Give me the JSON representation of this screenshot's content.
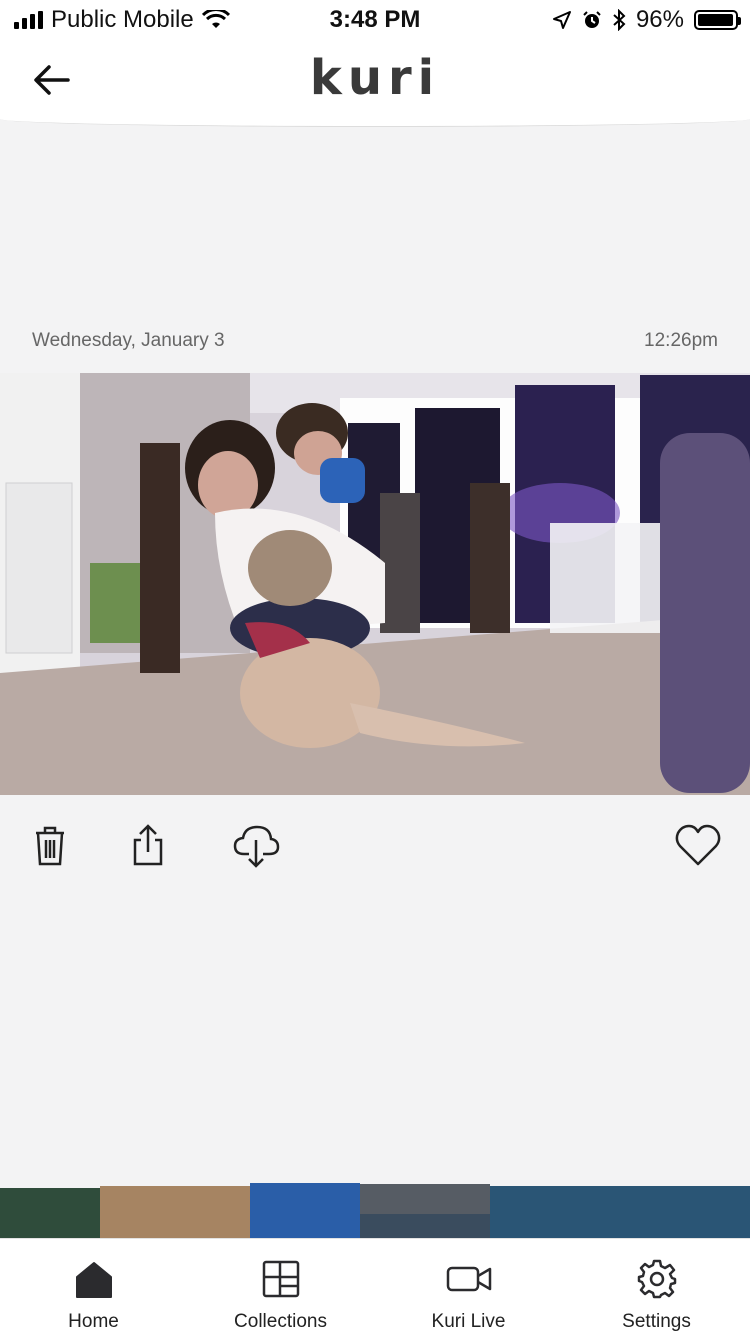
{
  "status_bar": {
    "carrier": "Public Mobile",
    "time": "3:48 PM",
    "battery_percent": "96%",
    "battery_level": 0.96
  },
  "header": {
    "logo": "kuri",
    "back_icon": "arrow-left-icon"
  },
  "capture": {
    "date": "Wednesday, January 3",
    "time": "12:26pm"
  },
  "actions": {
    "icons": [
      "trash-icon",
      "share-icon",
      "cloud-download-icon",
      "heart-icon"
    ]
  },
  "tabs": [
    {
      "label": "Home",
      "icon": "home-icon",
      "active": true
    },
    {
      "label": "Collections",
      "icon": "collections-icon",
      "active": false
    },
    {
      "label": "Kuri Live",
      "icon": "video-camera-icon",
      "active": false
    },
    {
      "label": "Settings",
      "icon": "gear-icon",
      "active": false
    }
  ]
}
